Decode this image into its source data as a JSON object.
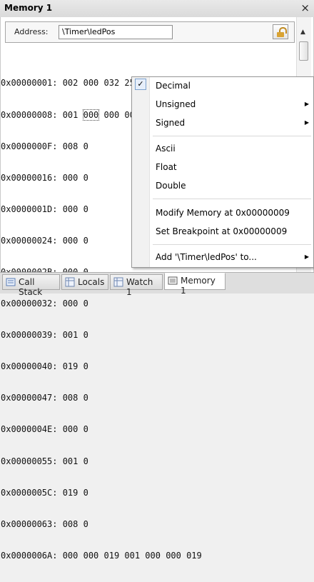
{
  "window": {
    "title": "Memory 1",
    "close_glyph": "×"
  },
  "address": {
    "label": "Address:",
    "value": "\\Timer\\ledPos"
  },
  "memory_rows": [
    "0x00000001: 002 000 032 253 000 000 008",
    "0x00000008: 001 000 000 000 003 001 000",
    "0x0000000F: 008 0",
    "0x00000016: 000 0",
    "0x0000001D: 000 0",
    "0x00000024: 000 0",
    "0x0000002B: 000 0",
    "0x00000032: 000 0",
    "0x00000039: 001 0",
    "0x00000040: 019 0",
    "0x00000047: 008 0",
    "0x0000004E: 000 0",
    "0x00000055: 001 0",
    "0x0000005C: 019 0",
    "0x00000063: 008 0",
    "0x0000006A: 000 000 019 001 000 000 019"
  ],
  "context_menu": {
    "items": [
      {
        "label": "Decimal",
        "checked": true,
        "submenu": false
      },
      {
        "label": "Unsigned",
        "checked": false,
        "submenu": true
      },
      {
        "label": "Signed",
        "checked": false,
        "submenu": true
      },
      {
        "label": "Ascii",
        "checked": false,
        "submenu": false
      },
      {
        "label": "Float",
        "checked": false,
        "submenu": false
      },
      {
        "label": "Double",
        "checked": false,
        "submenu": false
      },
      {
        "label": "Modify Memory at 0x00000009",
        "checked": false,
        "submenu": false
      },
      {
        "label": "Set Breakpoint at 0x00000009",
        "checked": false,
        "submenu": false
      },
      {
        "label": "Add '\\Timer\\ledPos' to...",
        "checked": false,
        "submenu": true
      }
    ],
    "check_glyph": "✓",
    "submenu_glyph": "▶"
  },
  "tabs": [
    {
      "label": "Call Stack",
      "icon": "call-stack-icon"
    },
    {
      "label": "Locals",
      "icon": "locals-icon"
    },
    {
      "label": "Watch 1",
      "icon": "watch-icon"
    },
    {
      "label": "Memory 1",
      "icon": "memory-icon",
      "active": true
    }
  ]
}
